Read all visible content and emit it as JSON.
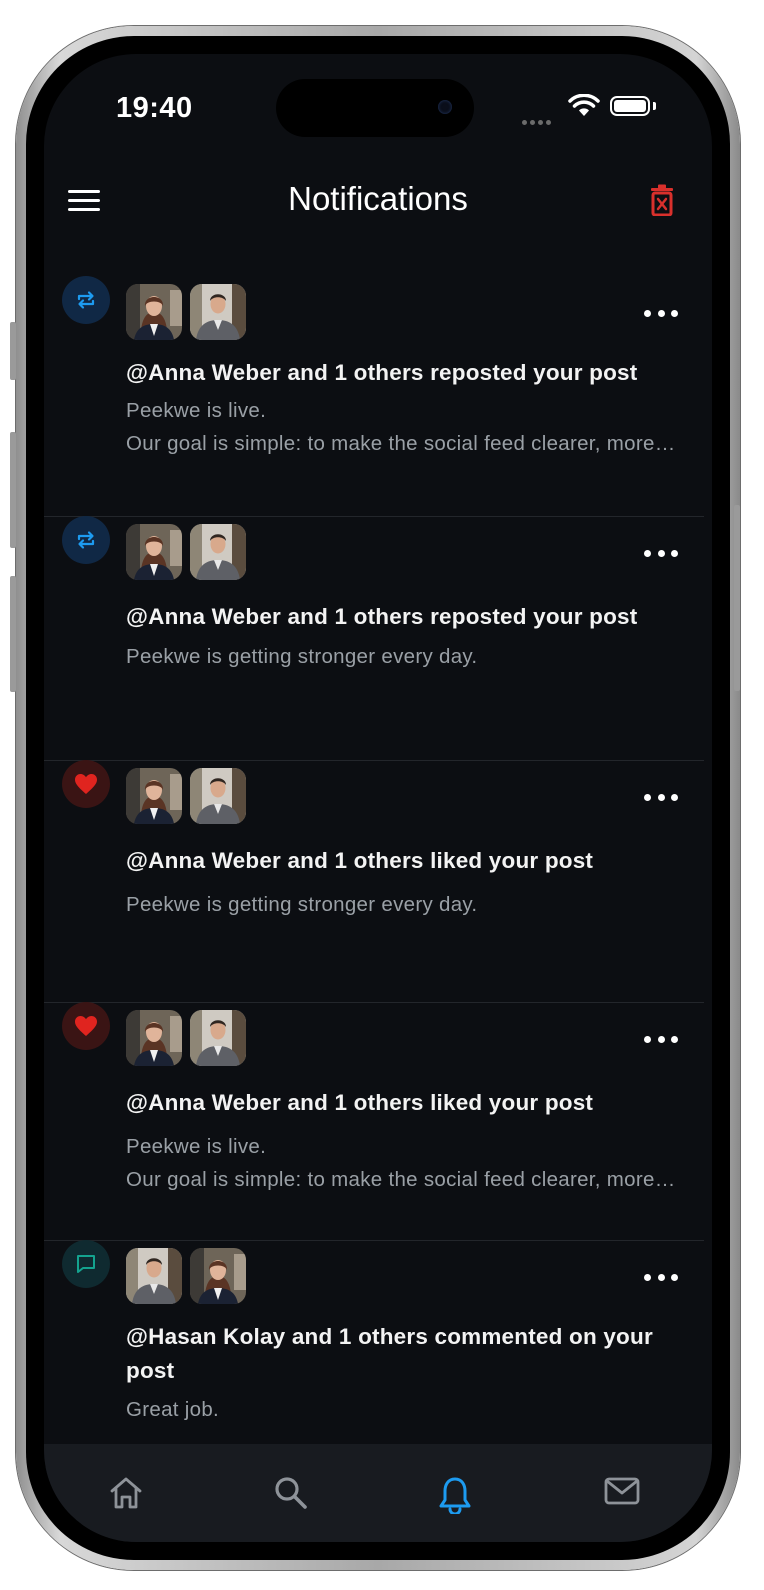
{
  "status_bar": {
    "time": "19:40"
  },
  "header": {
    "title": "Notifications"
  },
  "colors": {
    "accent": "#1d9bf0",
    "like": "#e0245e",
    "danger": "#d9302c",
    "background": "#0c0e12"
  },
  "notifications": [
    {
      "type": "repost",
      "icon": "repost-icon",
      "title": "@Anna Weber and 1 others reposted your post",
      "lines": [
        "Peekwe is live.",
        "Our goal is simple: to make the social feed clearer, more relevant and more transparent."
      ]
    },
    {
      "type": "repost",
      "icon": "repost-icon",
      "title": "@Anna Weber and 1 others reposted your post",
      "lines": [
        "Peekwe is getting stronger every day."
      ]
    },
    {
      "type": "like",
      "icon": "heart-icon",
      "title": "@Anna Weber and 1 others liked your post",
      "lines": [
        "Peekwe is getting stronger every day."
      ]
    },
    {
      "type": "like",
      "icon": "heart-icon",
      "title": "@Anna Weber and 1 others liked your post",
      "lines": [
        "Peekwe is live.",
        "Our goal is simple: to make the social feed clearer, more relevant and more transparent."
      ]
    },
    {
      "type": "comment",
      "icon": "comment-icon",
      "title": "@Hasan Kolay and 1 others commented on your post",
      "lines": [
        "Great job."
      ]
    }
  ],
  "tabbar": {
    "items": [
      "home-icon",
      "search-icon",
      "bell-icon",
      "mail-icon"
    ],
    "active": "bell-icon"
  }
}
